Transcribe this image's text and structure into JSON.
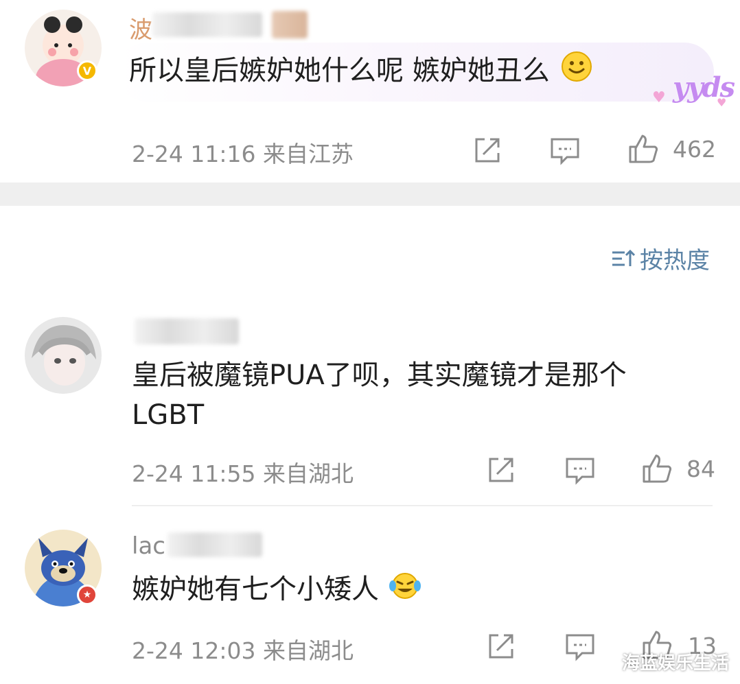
{
  "comments": [
    {
      "username_visible": "波",
      "text": "所以皇后嫉妒她什么呢 嫉妒她丑么",
      "emoji": "smile-emoji",
      "decoration": "yyds",
      "badge": "V",
      "badge_color": "#f5b800",
      "date": "2-24",
      "time": "11:16",
      "location": "来自江苏",
      "likes": "462"
    },
    {
      "username_visible": "",
      "text_line1": "皇后被魔镜PUA了呗，其实魔镜才是那个",
      "text_line2": "LGBT",
      "date": "2-24",
      "time": "11:55",
      "location": "来自湖北",
      "likes": "84"
    },
    {
      "username_visible": "lac",
      "text": "嫉妒她有七个小矮人",
      "emoji": "laughing-crying-emoji",
      "badge": "★",
      "badge_color": "#e0453a",
      "date": "2-24",
      "time": "12:03",
      "location": "来自湖北",
      "likes": "13"
    }
  ],
  "sort": {
    "label": "按热度",
    "icon": "sort-icon"
  },
  "watermark": "海蓝娱乐生活",
  "colors": {
    "meta": "#8c8c8c",
    "sort": "#5b83a6",
    "divider": "#efefef"
  }
}
